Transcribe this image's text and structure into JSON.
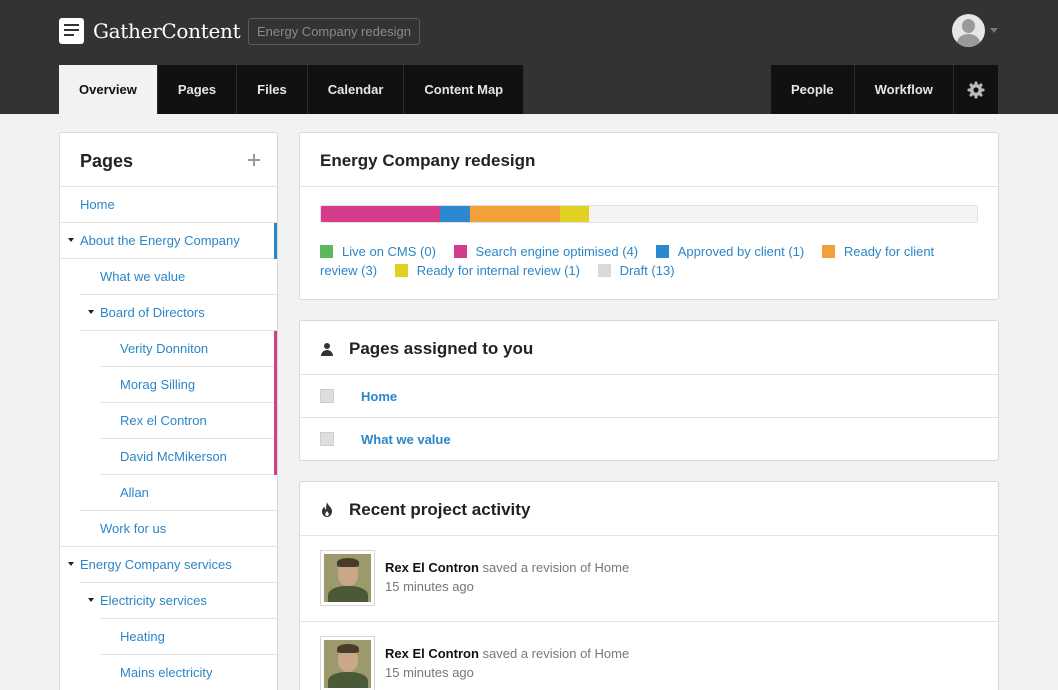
{
  "header": {
    "app_name": "GatherContent",
    "project_name": "Energy Company redesign",
    "tabs_left": [
      "Overview",
      "Pages",
      "Files",
      "Calendar",
      "Content Map"
    ],
    "tabs_right": [
      "People",
      "Workflow"
    ],
    "active_tab": "Overview"
  },
  "sidebar": {
    "title": "Pages",
    "items": [
      {
        "label": "Home",
        "status_color": ""
      },
      {
        "label": "About the Energy Company",
        "status_color": "#2b86c7"
      },
      {
        "label": "What we value",
        "status_color": ""
      },
      {
        "label": "Board of Directors",
        "status_color": ""
      },
      {
        "label": "Verity Donniton",
        "status_color": "#d63c8c"
      },
      {
        "label": "Morag Silling",
        "status_color": "#d63c8c"
      },
      {
        "label": "Rex el Contron",
        "status_color": "#d63c8c"
      },
      {
        "label": "David McMikerson",
        "status_color": "#d63c8c"
      },
      {
        "label": "Allan",
        "status_color": ""
      },
      {
        "label": "Work for us",
        "status_color": ""
      },
      {
        "label": "Energy Company services",
        "status_color": ""
      },
      {
        "label": "Electricity services",
        "status_color": ""
      },
      {
        "label": "Heating",
        "status_color": ""
      },
      {
        "label": "Mains electricity",
        "status_color": ""
      }
    ]
  },
  "overview": {
    "title": "Energy Company redesign",
    "progress": [
      {
        "status": "Search engine optimised",
        "count": 4,
        "color": "#d63c8c"
      },
      {
        "status": "Approved by client",
        "count": 1,
        "color": "#2d89cf"
      },
      {
        "status": "Ready for client review",
        "count": 3,
        "color": "#f2a03a"
      },
      {
        "status": "Ready for internal review",
        "count": 1,
        "color": "#e2d023"
      },
      {
        "status": "Draft",
        "count": 13,
        "color": "#f4f4f4"
      }
    ],
    "legend": [
      {
        "label": "Live on CMS (0)",
        "color": "#5cb85c"
      },
      {
        "label": "Search engine optimised (4)",
        "color": "#d63c8c"
      },
      {
        "label": "Approved by client (1)",
        "color": "#2d89cf"
      },
      {
        "label": "Ready for client review (3)",
        "color": "#f2a03a"
      },
      {
        "label": "Ready for internal review (1)",
        "color": "#e2d023"
      },
      {
        "label": "Draft (13)",
        "color": "#d9d9d9"
      }
    ]
  },
  "assigned": {
    "title": "Pages assigned to you",
    "items": [
      "Home",
      "What we value"
    ]
  },
  "activity": {
    "title": "Recent project activity",
    "items": [
      {
        "user": "Rex El Contron",
        "action": "saved a revision of Home",
        "time": "15 minutes ago"
      },
      {
        "user": "Rex El Contron",
        "action": "saved a revision of Home",
        "time": "15 minutes ago"
      }
    ]
  }
}
